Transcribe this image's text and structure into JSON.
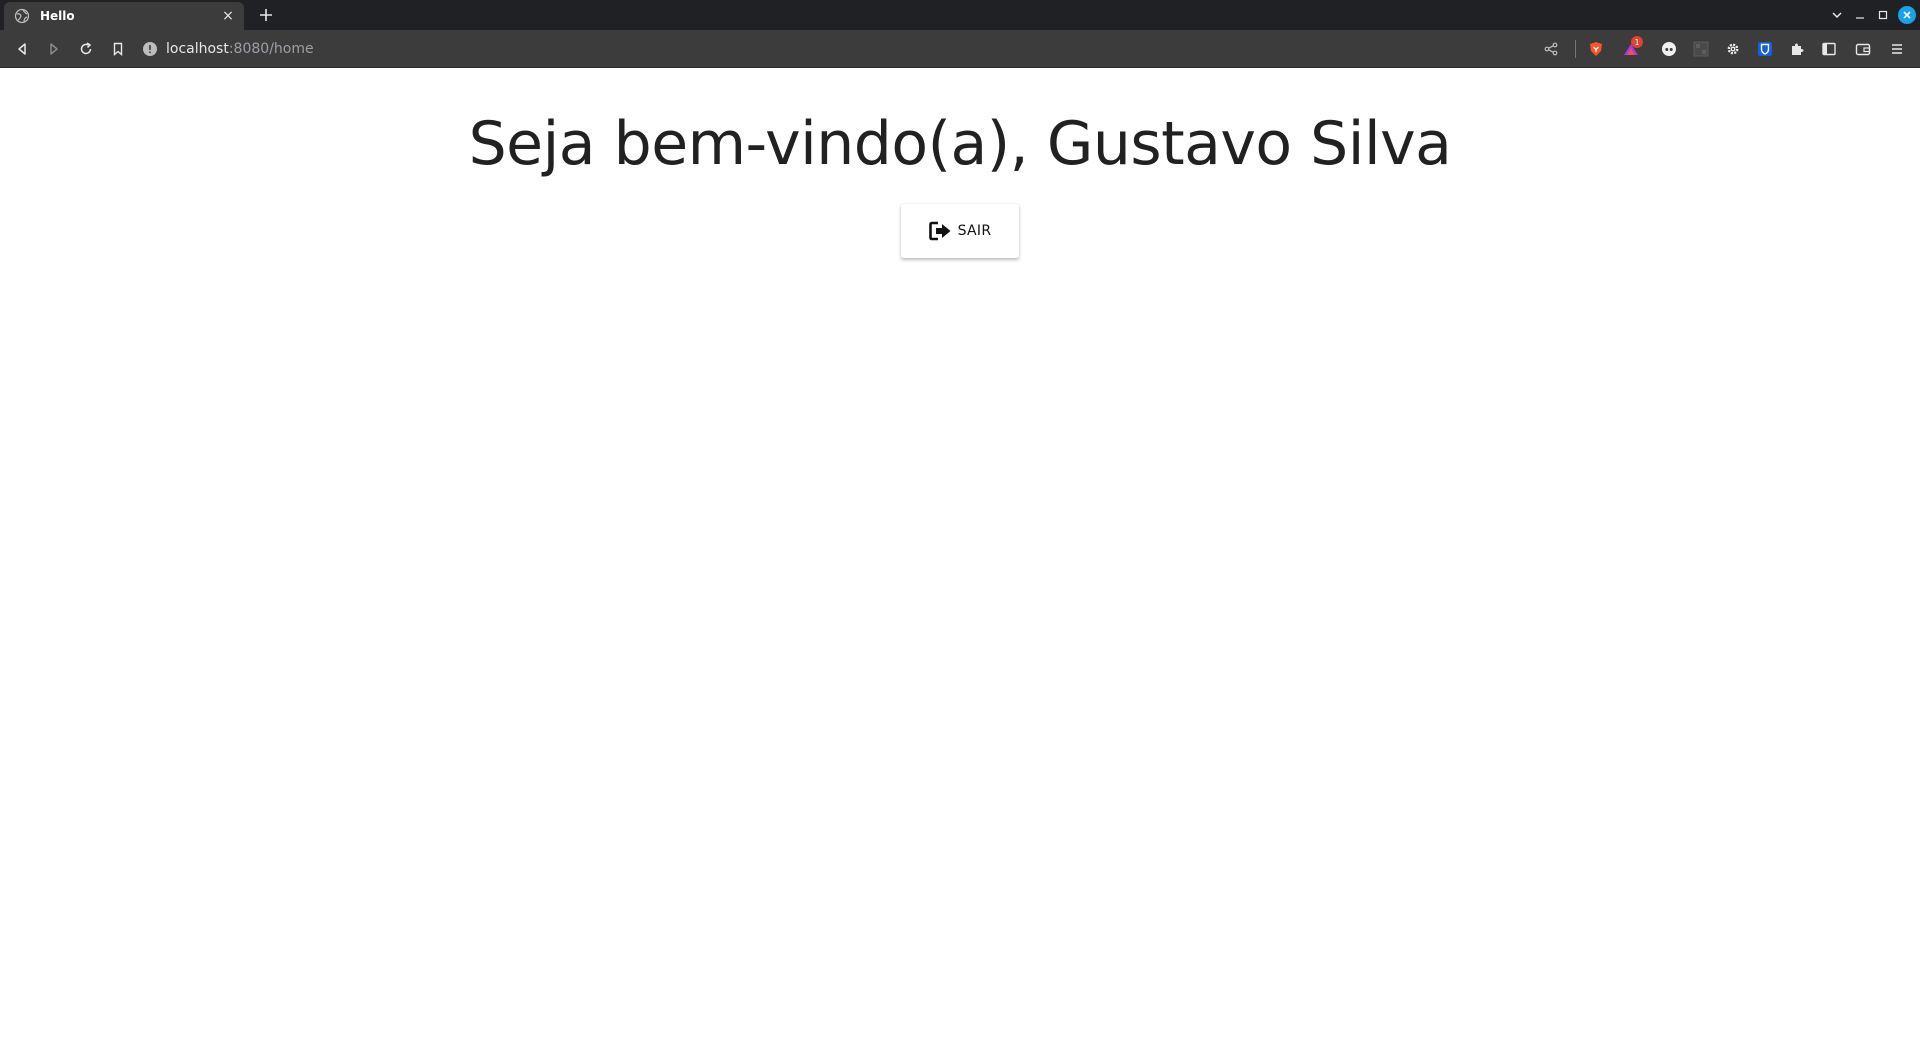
{
  "browser": {
    "tab": {
      "title": "Hello",
      "close_glyph": "×"
    },
    "new_tab_glyph": "+",
    "address": {
      "host": "localhost",
      "path": ":8080/home"
    },
    "extension_badge": "1"
  },
  "page": {
    "greeting": "Seja bem-vindo(a), Gustavo Silva",
    "logout_button": {
      "label": "SAIR",
      "icon": "sign-out-icon"
    }
  },
  "colors": {
    "tab_bar_bg": "#202124",
    "toolbar_bg": "#3c3c3c",
    "brave_orange": "#fb542b",
    "bitwarden_blue": "#175ddc",
    "close_blue": "#1aa1e6"
  }
}
